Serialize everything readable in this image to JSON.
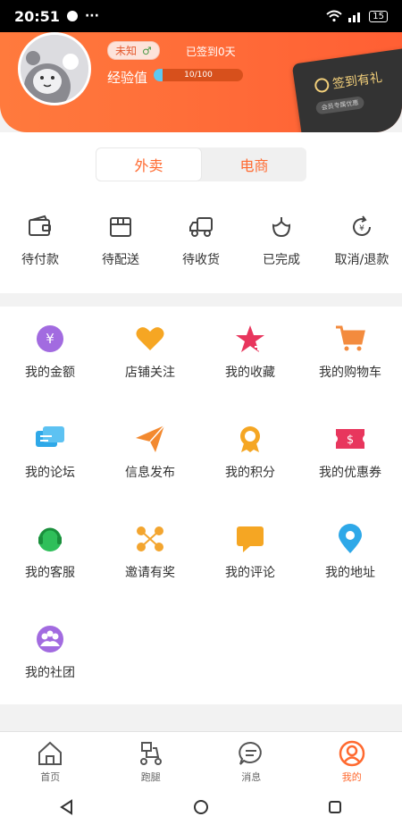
{
  "status": {
    "time": "20:51",
    "more": "···",
    "battery": "15"
  },
  "profile": {
    "gender_label": "未知",
    "gender_icon": "male-icon",
    "signin_days_text": "已签到0天",
    "exp_label": "经验值",
    "exp_value": "10/100",
    "exp_fraction": 0.1
  },
  "signin_card": {
    "title": "签到有礼",
    "subtitle": "会员专属优惠"
  },
  "segments": [
    {
      "label": "外卖",
      "active": true
    },
    {
      "label": "电商",
      "active": false
    }
  ],
  "orders": [
    {
      "label": "待付款",
      "icon": "wallet-icon"
    },
    {
      "label": "待配送",
      "icon": "box-icon"
    },
    {
      "label": "待收货",
      "icon": "truck-icon"
    },
    {
      "label": "已完成",
      "icon": "check-flower-icon"
    },
    {
      "label": "取消/退款",
      "icon": "refund-icon"
    }
  ],
  "grid": [
    {
      "label": "我的金额",
      "icon": "yen-icon",
      "color": "#a26be0"
    },
    {
      "label": "店铺关注",
      "icon": "heart-icon",
      "color": "#f6a623"
    },
    {
      "label": "我的收藏",
      "icon": "star-icon",
      "color": "#e8365d"
    },
    {
      "label": "我的购物车",
      "icon": "cart-icon",
      "color": "#f38b3e"
    },
    {
      "label": "我的论坛",
      "icon": "chat-icon",
      "color": "#2ea8e8"
    },
    {
      "label": "信息发布",
      "icon": "send-icon",
      "color": "#f3892f"
    },
    {
      "label": "我的积分",
      "icon": "medal-icon",
      "color": "#f5a623"
    },
    {
      "label": "我的优惠券",
      "icon": "coupon-icon",
      "color": "#e8365d"
    },
    {
      "label": "我的客服",
      "icon": "headset-icon",
      "color": "#2fbf5a"
    },
    {
      "label": "邀请有奖",
      "icon": "share-icon",
      "color": "#f3a52f"
    },
    {
      "label": "我的评论",
      "icon": "comment-icon",
      "color": "#f5a623"
    },
    {
      "label": "我的地址",
      "icon": "location-icon",
      "color": "#2ea8e8"
    },
    {
      "label": "我的社团",
      "icon": "group-icon",
      "color": "#a26be0"
    }
  ],
  "tabbar": [
    {
      "label": "首页",
      "icon": "home-icon",
      "active": false
    },
    {
      "label": "跑腿",
      "icon": "scooter-icon",
      "active": false
    },
    {
      "label": "消息",
      "icon": "message-icon",
      "active": false
    },
    {
      "label": "我的",
      "icon": "user-icon",
      "active": true
    }
  ],
  "colors": {
    "brand": "#ff6a30",
    "header_start": "#ff7a3d",
    "header_end": "#ff5f34"
  }
}
